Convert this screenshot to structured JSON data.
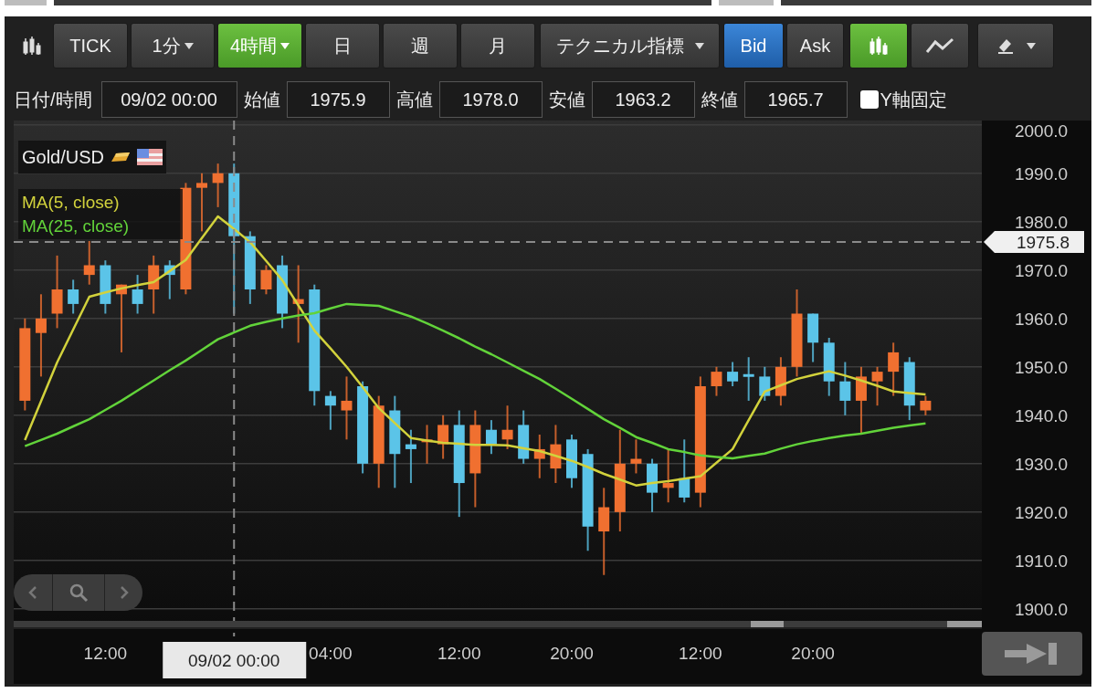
{
  "toolbar": {
    "periods": [
      {
        "label": "TICK",
        "selected": false,
        "dropdown": false
      },
      {
        "label": "1分",
        "selected": false,
        "dropdown": true
      },
      {
        "label": "4時間",
        "selected": true,
        "dropdown": true
      },
      {
        "label": "日",
        "selected": false,
        "dropdown": false
      },
      {
        "label": "週",
        "selected": false,
        "dropdown": false
      },
      {
        "label": "月",
        "selected": false,
        "dropdown": false
      }
    ],
    "indicator_menu": {
      "label": "テクニカル指標"
    },
    "price_side": [
      {
        "label": "Bid",
        "selected": true
      },
      {
        "label": "Ask",
        "selected": false
      }
    ],
    "chart_types": [
      {
        "selected": true
      },
      {
        "selected": false
      }
    ]
  },
  "ohlc": [
    {
      "label": "日付/時間",
      "value": "09/02 00:00"
    },
    {
      "label": "始値",
      "value": "1975.9"
    },
    {
      "label": "高値",
      "value": "1978.0"
    },
    {
      "label": "安値",
      "value": "1963.2"
    },
    {
      "label": "終値",
      "value": "1965.7"
    }
  ],
  "y_axis_lock": {
    "label": "Y軸固定",
    "checked": false
  },
  "chart": {
    "symbol": "Gold/USD",
    "chart_data": {
      "type": "candlestick",
      "categories": [
        null,
        null,
        null,
        null,
        null,
        "12:00",
        null,
        null,
        null,
        null,
        null,
        null,
        null,
        "09/02 00:00",
        null,
        null,
        null,
        null,
        null,
        "04:00",
        null,
        null,
        null,
        null,
        null,
        null,
        null,
        "12:00",
        null,
        null,
        null,
        null,
        null,
        null,
        "20:00",
        null,
        null,
        null,
        null,
        null,
        null,
        null,
        "12:00",
        null,
        null,
        null,
        null,
        null,
        null,
        "20:00",
        null,
        null,
        null,
        null,
        null,
        null,
        null
      ],
      "ohlc": [
        [
          1943,
          1960,
          1941,
          1958
        ],
        [
          1957,
          1965,
          1948,
          1960
        ],
        [
          1961,
          1973,
          1958,
          1966
        ],
        [
          1966,
          1968,
          1961,
          1963
        ],
        [
          1969,
          1976,
          1967,
          1971
        ],
        [
          1971,
          1972,
          1961,
          1963
        ],
        [
          1965,
          1967,
          1953,
          1967
        ],
        [
          1966,
          1969,
          1961,
          1963
        ],
        [
          1966,
          1973,
          1961,
          1971
        ],
        [
          1971,
          1972,
          1964,
          1969
        ],
        [
          1966,
          1988,
          1965,
          1987
        ],
        [
          1987,
          1990,
          1978,
          1988
        ],
        [
          1988,
          1992,
          1983,
          1990
        ],
        [
          1990,
          1992,
          1961,
          1977
        ],
        [
          1977,
          1978,
          1963,
          1966
        ],
        [
          1966,
          1971,
          1965,
          1970
        ],
        [
          1971,
          1973,
          1958,
          1961
        ],
        [
          1963,
          1971,
          1955,
          1964
        ],
        [
          1966,
          1967,
          1942,
          1945
        ],
        [
          1944,
          1945,
          1937,
          1942
        ],
        [
          1941,
          1948,
          1935,
          1943
        ],
        [
          1946,
          1947,
          1928,
          1930
        ],
        [
          1930,
          1944,
          1925,
          1942
        ],
        [
          1941,
          1944,
          1925,
          1932
        ],
        [
          1934,
          1937,
          1926,
          1933
        ],
        [
          1934.5,
          1938,
          1930,
          1935
        ],
        [
          1934,
          1940,
          1931,
          1938
        ],
        [
          1938,
          1941,
          1919,
          1926
        ],
        [
          1928,
          1941,
          1921,
          1938
        ],
        [
          1937,
          1939,
          1932,
          1934
        ],
        [
          1935,
          1942,
          1933,
          1937
        ],
        [
          1938,
          1941,
          1930,
          1931
        ],
        [
          1931,
          1936,
          1927,
          1933
        ],
        [
          1929,
          1938,
          1926,
          1934
        ],
        [
          1935,
          1936,
          1925,
          1927
        ],
        [
          1932,
          1933,
          1912,
          1917
        ],
        [
          1916,
          1925,
          1907,
          1921
        ],
        [
          1920,
          1937,
          1916,
          1930
        ],
        [
          1930,
          1935,
          1928,
          1931
        ],
        [
          1930,
          1931,
          1920,
          1924
        ],
        [
          1925,
          1933,
          1922,
          1926
        ],
        [
          1927,
          1935,
          1922,
          1923
        ],
        [
          1924,
          1948,
          1921,
          1946
        ],
        [
          1946,
          1950,
          1944,
          1949
        ],
        [
          1949,
          1951,
          1946,
          1947
        ],
        [
          1948.5,
          1952,
          1943,
          1948
        ],
        [
          1948,
          1950,
          1943,
          1944
        ],
        [
          1944,
          1952,
          1942,
          1950
        ],
        [
          1950,
          1966,
          1948,
          1961
        ],
        [
          1961,
          1961,
          1951,
          1955
        ],
        [
          1955,
          1956,
          1944,
          1947
        ],
        [
          1947,
          1951,
          1940,
          1943
        ],
        [
          1943,
          1950,
          1936,
          1948
        ],
        [
          1947,
          1950,
          1942,
          1949
        ],
        [
          1949,
          1955,
          1944,
          1953
        ],
        [
          1951,
          1952,
          1939,
          1942
        ],
        [
          1941,
          1944,
          1940,
          1943
        ]
      ],
      "series": [
        {
          "name": "MA(5, close)",
          "type": "line",
          "color": "#d2d23c",
          "values": [
            1934.9,
            1942.9,
            1950.9,
            1957.7,
            1964.5,
            1965.4,
            1966.2,
            1966.9,
            1967.5,
            1969.8,
            1972.1,
            1976.6,
            1981.1,
            1978.5,
            1975.8,
            1971.9,
            1967.9,
            1962.7,
            1957.5,
            1953.8,
            1950.0,
            1945.8,
            1941.5,
            1938.4,
            1935.3,
            1934.8,
            1934.3,
            1934.1,
            1933.9,
            1933.9,
            1933.8,
            1933.2,
            1932.6,
            1931.6,
            1930.6,
            1929.3,
            1927.9,
            1926.7,
            1925.5,
            1926.0,
            1926.4,
            1926.9,
            1927.4,
            1930.2,
            1933.0,
            1939.0,
            1944.9,
            1946.2,
            1947.5,
            1948.3,
            1949.1,
            1948.2,
            1947.2,
            1946.1,
            1944.9,
            1944.6,
            1944.3
          ]
        },
        {
          "name": "MA(25, close)",
          "type": "line",
          "color": "#62d33a",
          "values": [
            1933.6,
            1934.9,
            1936.2,
            1937.7,
            1939.2,
            1941.1,
            1943.0,
            1945.1,
            1947.2,
            1949.3,
            1951.3,
            1953.5,
            1955.7,
            1957.1,
            1958.5,
            1959.3,
            1960.0,
            1960.6,
            1961.1,
            1962.1,
            1963.0,
            1962.8,
            1962.6,
            1961.5,
            1960.4,
            1959.0,
            1957.5,
            1955.9,
            1954.2,
            1952.6,
            1950.9,
            1949.2,
            1947.5,
            1945.5,
            1943.4,
            1941.3,
            1939.2,
            1937.4,
            1935.5,
            1934.3,
            1933.0,
            1932.4,
            1931.7,
            1931.4,
            1931.1,
            1931.6,
            1932.1,
            1933.1,
            1934.0,
            1934.7,
            1935.3,
            1935.8,
            1936.2,
            1936.8,
            1937.4,
            1937.9,
            1938.3
          ]
        }
      ],
      "grid": true,
      "ylim": [
        1896.2,
        2000.9
      ],
      "yticks": [
        {
          "value": 1900,
          "label": "1900.0"
        },
        {
          "value": 1910,
          "label": "1910.0"
        },
        {
          "value": 1920,
          "label": "1920.0"
        },
        {
          "value": 1930,
          "label": "1930.0"
        },
        {
          "value": 1940,
          "label": "1940.0"
        },
        {
          "value": 1950,
          "label": "1950.0"
        },
        {
          "value": 1960,
          "label": "1960.0"
        },
        {
          "value": 1970,
          "label": "1970.0"
        },
        {
          "value": 1980,
          "label": "1980.0"
        },
        {
          "value": 1990,
          "label": "1990.0"
        },
        {
          "value": 2000,
          "label": "2000.0"
        }
      ],
      "ref_lines": [
        {
          "axis": "x",
          "value": "09/02 00:00"
        },
        {
          "axis": "y",
          "value": 1975.8,
          "label": "1975.8"
        }
      ]
    }
  }
}
